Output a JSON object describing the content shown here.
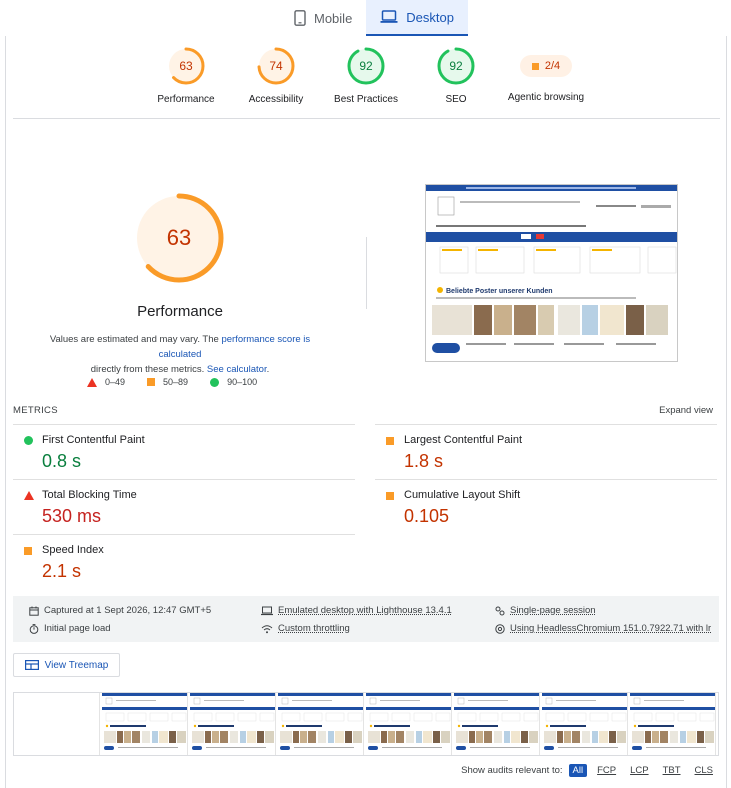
{
  "tabs": [
    {
      "label": "Mobile",
      "icon": "phone-icon"
    },
    {
      "label": "Desktop",
      "icon": "laptop-icon",
      "active": true
    }
  ],
  "categories": [
    {
      "label": "Performance",
      "score": "63",
      "color": "#fa9b28",
      "fraction": 0.63
    },
    {
      "label": "Accessibility",
      "score": "74",
      "color": "#fa9b28",
      "fraction": 0.74
    },
    {
      "label": "Best Practices",
      "score": "92",
      "color": "#22c25c",
      "fraction": 0.92
    },
    {
      "label": "SEO",
      "score": "92",
      "color": "#22c25c",
      "fraction": 0.92
    },
    {
      "label": "Agentic browsing",
      "score": "2/4",
      "color": "#fa9b28"
    }
  ],
  "performance": {
    "score": "63",
    "fraction": 0.63,
    "title": "Performance",
    "desc_prefix": "Values are estimated and may vary. The ",
    "desc_link1": "performance score is calculated",
    "desc_middle": " directly from these metrics. ",
    "desc_link2": "See calculator",
    "desc_suffix": "."
  },
  "legend": [
    {
      "range": "0–49",
      "shape": "triangle",
      "color": "#eb3323"
    },
    {
      "range": "50–89",
      "shape": "square",
      "color": "#fa9b28"
    },
    {
      "range": "90–100",
      "shape": "circle",
      "color": "#22c25c"
    }
  ],
  "screenshot": {
    "heading": "Beliebte Poster unserer Kunden"
  },
  "metrics": {
    "heading": "METRICS",
    "expand": "Expand view",
    "items": [
      {
        "name": "First Contentful Paint",
        "value": "0.8 s",
        "rating": "pass"
      },
      {
        "name": "Largest Contentful Paint",
        "value": "1.8 s",
        "rating": "average"
      },
      {
        "name": "Total Blocking Time",
        "value": "530 ms",
        "rating": "fail"
      },
      {
        "name": "Cumulative Layout Shift",
        "value": "0.105",
        "rating": "average"
      },
      {
        "name": "Speed Index",
        "value": "2.1 s",
        "rating": "average"
      }
    ]
  },
  "runtime": {
    "captured": "Captured at 1 Sept 2026, 12:47 GMT+5",
    "emulated": "Emulated desktop with Lighthouse 13.4.1",
    "session": "Single-page session",
    "initial": "Initial page load",
    "throttling": "Custom throttling",
    "browser": "Using HeadlessChromium 151.0.7922.71 with lr"
  },
  "treemap_label": "View Treemap",
  "filter": {
    "label": "Show audits relevant to:",
    "chips": [
      "All",
      "FCP",
      "LCP",
      "TBT",
      "CLS"
    ]
  }
}
